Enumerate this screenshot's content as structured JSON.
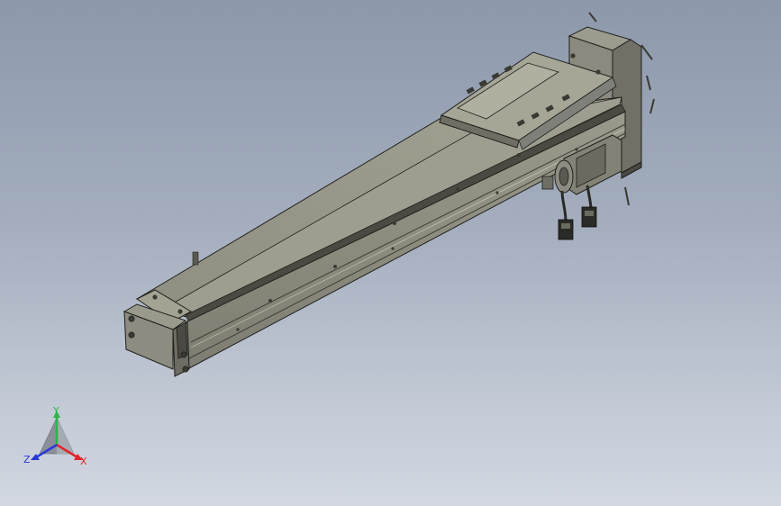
{
  "viewport": {
    "background_top": "#8d98ab",
    "background_bottom": "#d2d7e1",
    "model": "linear-actuator-assembly"
  },
  "model_colors": {
    "top_face": "#9d9d8f",
    "front_face": "#8c8c80",
    "side_face": "#6e6e63",
    "dark_face": "#4a4a42",
    "edge": "#1f1f1c",
    "carriage_top": "#a6a697",
    "motor_block": "#828276"
  },
  "triad": {
    "x_label": "X",
    "y_label": "Y",
    "z_label": "Z",
    "x_color": "#e0262a",
    "y_color": "#2fb24a",
    "z_color": "#2a38d8",
    "cone_color": "#8a8f9a"
  }
}
